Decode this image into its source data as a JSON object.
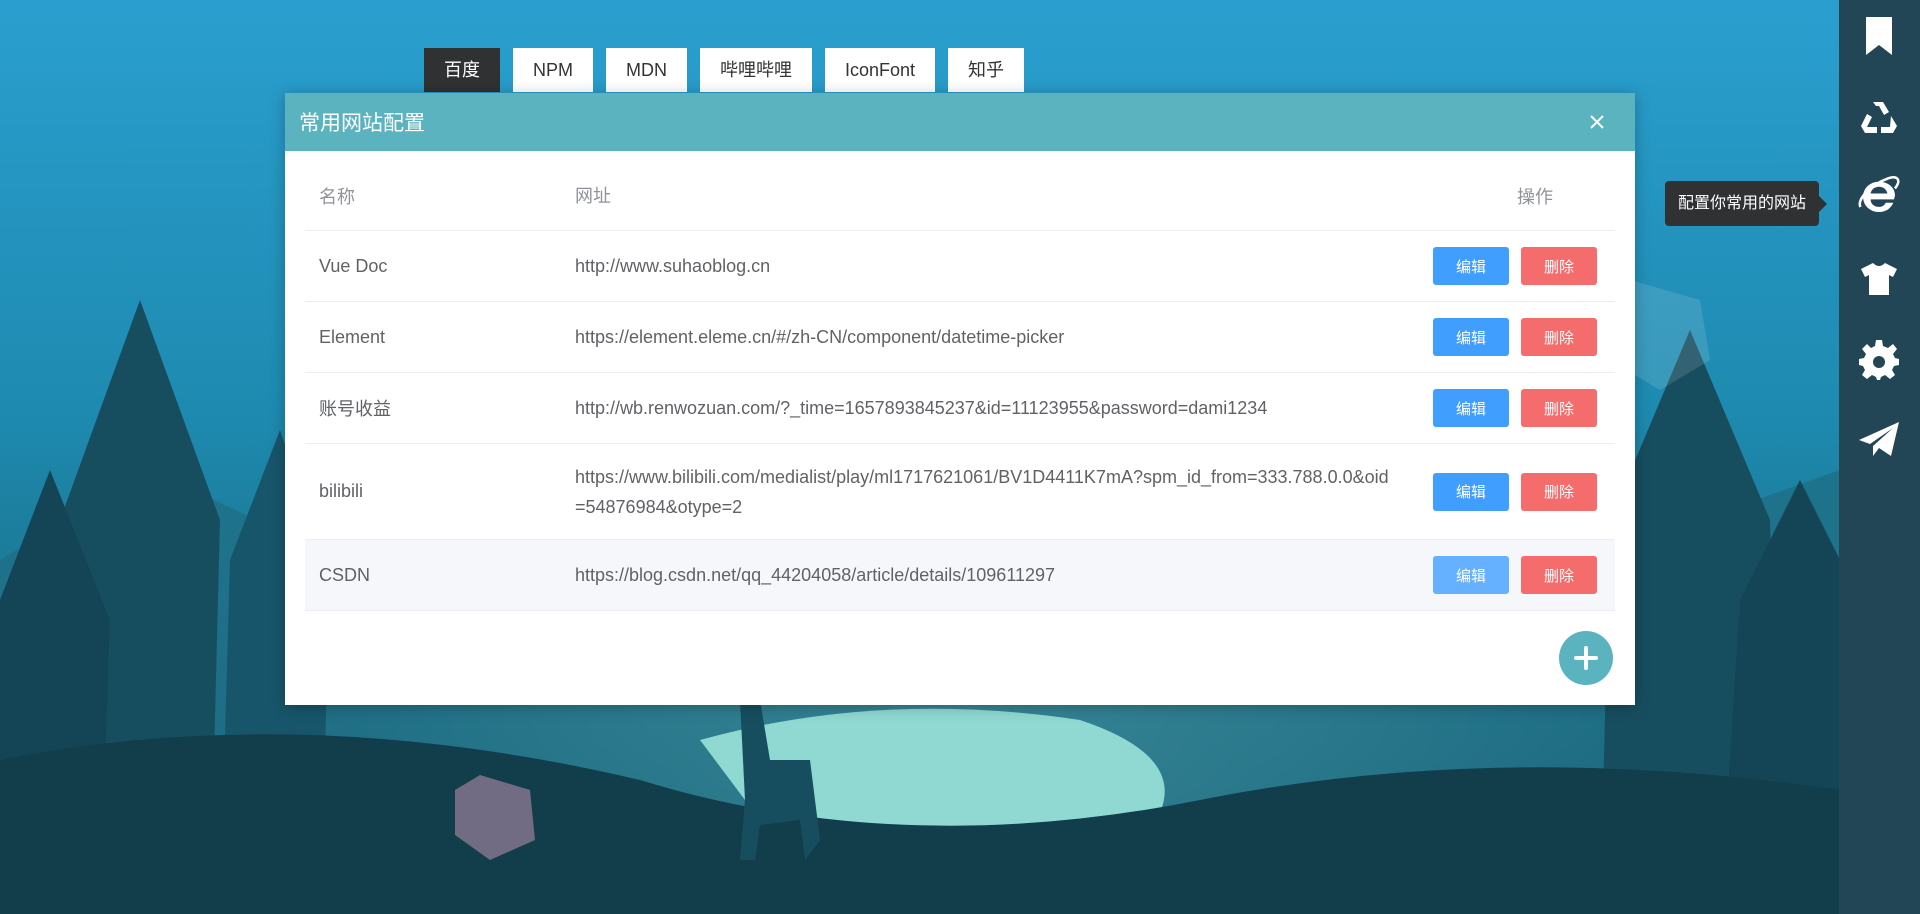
{
  "shortcuts": [
    {
      "label": "百度",
      "active": true
    },
    {
      "label": "NPM"
    },
    {
      "label": "MDN"
    },
    {
      "label": "哔哩哔哩"
    },
    {
      "label": "IconFont"
    },
    {
      "label": "知乎"
    }
  ],
  "dialog": {
    "title": "常用网站配置",
    "columns": {
      "name": "名称",
      "url": "网址",
      "ops": "操作"
    },
    "rows": [
      {
        "name": "Vue Doc",
        "url": "http://www.suhaoblog.cn"
      },
      {
        "name": "Element",
        "url": "https://element.eleme.cn/#/zh-CN/component/datetime-picker"
      },
      {
        "name": "账号收益",
        "url": "http://wb.renwozuan.com/?_time=1657893845237&id=11123955&password=dami1234"
      },
      {
        "name": "bilibili",
        "url": "https://www.bilibili.com/medialist/play/ml1717621061/BV1D4411K7mA?spm_id_from=333.788.0.0&oid=54876984&otype=2"
      },
      {
        "name": "CSDN",
        "url": "https://blog.csdn.net/qq_44204058/article/details/109611297"
      }
    ],
    "edit_label": "编辑",
    "delete_label": "删除"
  },
  "sidebar": {
    "icons": [
      "bookmark-icon",
      "recycle-icon",
      "ie-browser-icon",
      "tshirt-icon",
      "gear-icon",
      "paper-plane-icon"
    ],
    "tooltip": "配置你常用的网站"
  },
  "colors": {
    "header": "#5ab3bf",
    "edit": "#409eff",
    "delete": "#f56c6c",
    "sidebar": "#234656",
    "active_tab": "#303133"
  }
}
